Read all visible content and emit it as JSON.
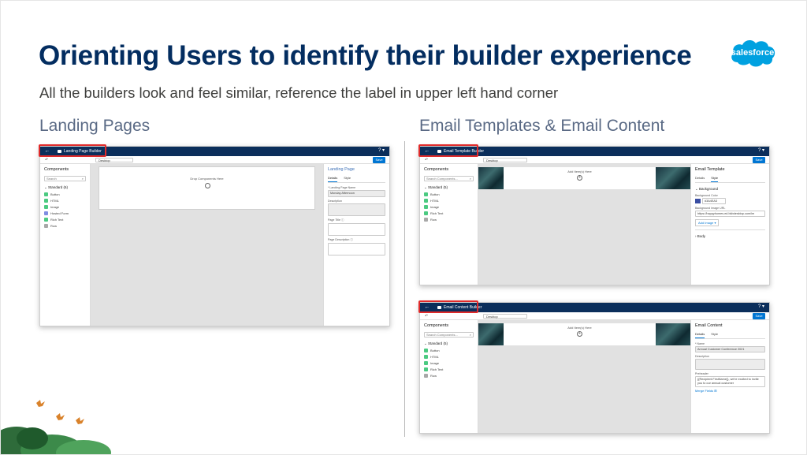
{
  "slide": {
    "title": "Orienting Users to identify their builder experience",
    "subtitle": "All the builders look and feel similar, reference the label in upper left hand corner",
    "left_heading": "Landing Pages",
    "right_heading": "Email Templates & Email Content",
    "logo_text": "salesforce",
    "colors": {
      "title": "#032d60",
      "heading": "#5a6a85",
      "app_header": "#0b2e5b",
      "highlight": "#e02b2b",
      "save": "#0176d3"
    }
  },
  "landing": {
    "builder_label": "Landing Page Builder",
    "help": "? ▾",
    "device": "Desktop",
    "save": "Save",
    "components_title": "Components",
    "search_placeholder": "Search",
    "standard_label": "Standard (6)",
    "components": [
      "Button",
      "HTML",
      "Image",
      "Hosted Form",
      "Rich Text",
      "Row"
    ],
    "drop_text": "Drop Components Here",
    "panel_title": "Landing Page",
    "tabs": [
      "Details",
      "Style"
    ],
    "name_label": "* Landing Page Name",
    "name_value": "Monday Afternoon",
    "description_label": "Description",
    "page_title_label": "Page Title",
    "page_description_label": "Page Description"
  },
  "template": {
    "builder_label": "Email Template Builder",
    "help": "? ▾",
    "device": "Desktop",
    "save": "Save",
    "components_title": "Components",
    "search_placeholder": "Search Components...",
    "standard_label": "Standard (5)",
    "components": [
      "Button",
      "HTML",
      "Image",
      "Rich Text",
      "Row"
    ],
    "add_item": "Add Item(s) Here",
    "panel_title": "Email Template",
    "tabs": [
      "Details",
      "Style"
    ],
    "background_section": "Background",
    "bg_color_label": "Background Color",
    "bg_color_value": "#3A4EA3",
    "bg_image_label": "Background Image URL",
    "bg_image_value": "https://happyhomes.ed.bkbdesktop.com/im",
    "add_image": "Add Image ▾",
    "body_section": "Body"
  },
  "content": {
    "builder_label": "Email Content Builder",
    "help": "? ▾",
    "device": "Desktop",
    "save": "Save",
    "components_title": "Components",
    "search_placeholder": "Search Components...",
    "standard_label": "Standard (5)",
    "components": [
      "Button",
      "HTML",
      "Image",
      "Rich Text",
      "Row"
    ],
    "add_item": "Add Item(s) Here",
    "panel_title": "Email Content",
    "tabs": [
      "Details",
      "Style"
    ],
    "name_label": "* Name",
    "name_value": "Annual Customer Conference 2021",
    "description_label": "Description",
    "preheader_label": "Preheader",
    "preheader_value": "{{Recipient.FirstName}}, we're excited to invite you to our annual customer",
    "merge_fields": "Merge Fields"
  }
}
